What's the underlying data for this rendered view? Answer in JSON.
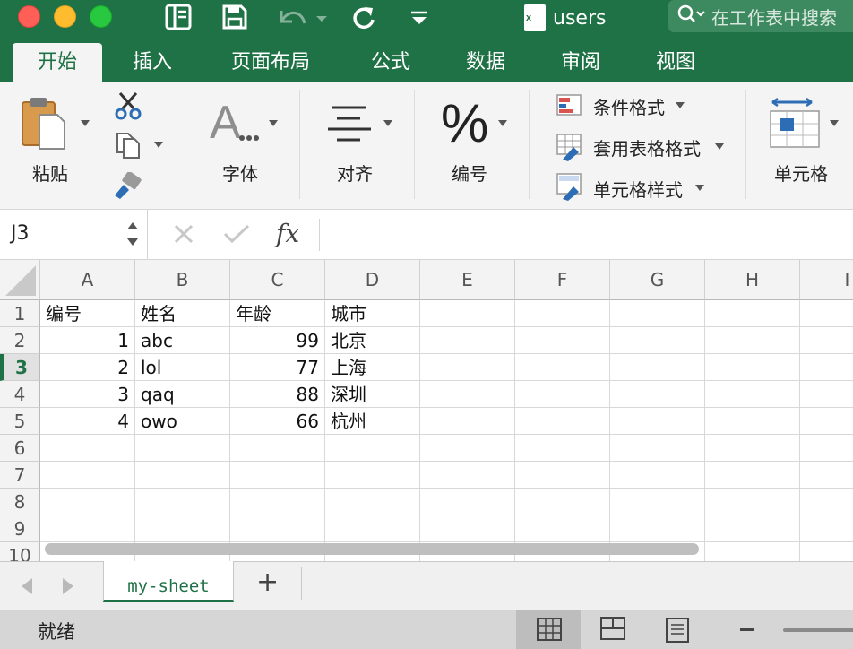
{
  "window": {
    "title": "users",
    "file_icon_letter": "x"
  },
  "search": {
    "placeholder": "在工作表中搜索"
  },
  "ribbon": {
    "tabs": [
      {
        "label": "开始",
        "active": true
      },
      {
        "label": "插入"
      },
      {
        "label": "页面布局"
      },
      {
        "label": "公式"
      },
      {
        "label": "数据"
      },
      {
        "label": "审阅"
      },
      {
        "label": "视图"
      }
    ],
    "groups": {
      "paste": "粘贴",
      "font": "字体",
      "align": "对齐",
      "number": "编号",
      "cells": "单元格"
    },
    "styles": {
      "conditional_format": "条件格式",
      "format_as_table": "套用表格格式",
      "cell_styles": "单元格样式"
    }
  },
  "formula_bar": {
    "name_box": "J3",
    "fx_label": "fx",
    "formula": ""
  },
  "sheet": {
    "columns": [
      "A",
      "B",
      "C",
      "D",
      "E",
      "F",
      "G",
      "H",
      "I"
    ],
    "rows": [
      "1",
      "2",
      "3",
      "4",
      "5",
      "6",
      "7",
      "8",
      "9",
      "10"
    ],
    "selected_row": "3",
    "data": [
      [
        "编号",
        "姓名",
        "年龄",
        "城市"
      ],
      [
        "1",
        "abc",
        "99",
        "北京"
      ],
      [
        "2",
        "lol",
        "77",
        "上海"
      ],
      [
        "3",
        "qaq",
        "88",
        "深圳"
      ],
      [
        "4",
        "owo",
        "66",
        "杭州"
      ]
    ]
  },
  "sheet_tabs": {
    "tabs": [
      "my-sheet"
    ],
    "add_label": "+"
  },
  "status": {
    "text": "就绪"
  },
  "colors": {
    "accent": "#1f7245",
    "ribbon_bg": "#f4f4f4",
    "statusbar_bg": "#d6d6d6"
  }
}
